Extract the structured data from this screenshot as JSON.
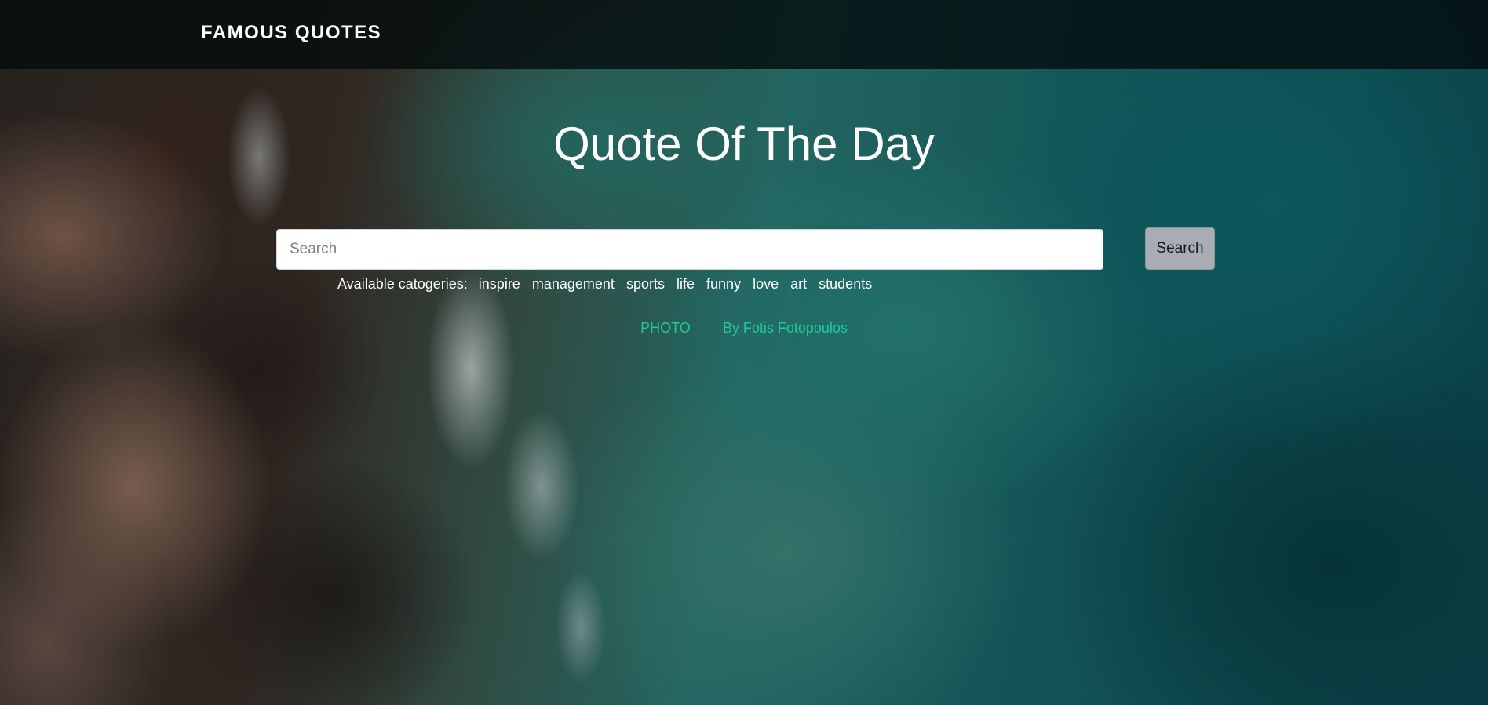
{
  "navbar": {
    "brand": "FAMOUS QUOTES"
  },
  "hero": {
    "title": "Quote Of The Day"
  },
  "search": {
    "placeholder": "Search",
    "value": "",
    "button_label": "Search"
  },
  "categories": {
    "label": "Available catogeries:",
    "items": [
      "inspire",
      "management",
      "sports",
      "life",
      "funny",
      "love",
      "art",
      "students"
    ]
  },
  "credits": {
    "photo_label": "PHOTO",
    "author_label": "By Fotis Fotopoulos"
  },
  "colors": {
    "navbar_bg": "#050c0e",
    "link_accent": "#20c997",
    "button_bg": "#a7adb3"
  }
}
